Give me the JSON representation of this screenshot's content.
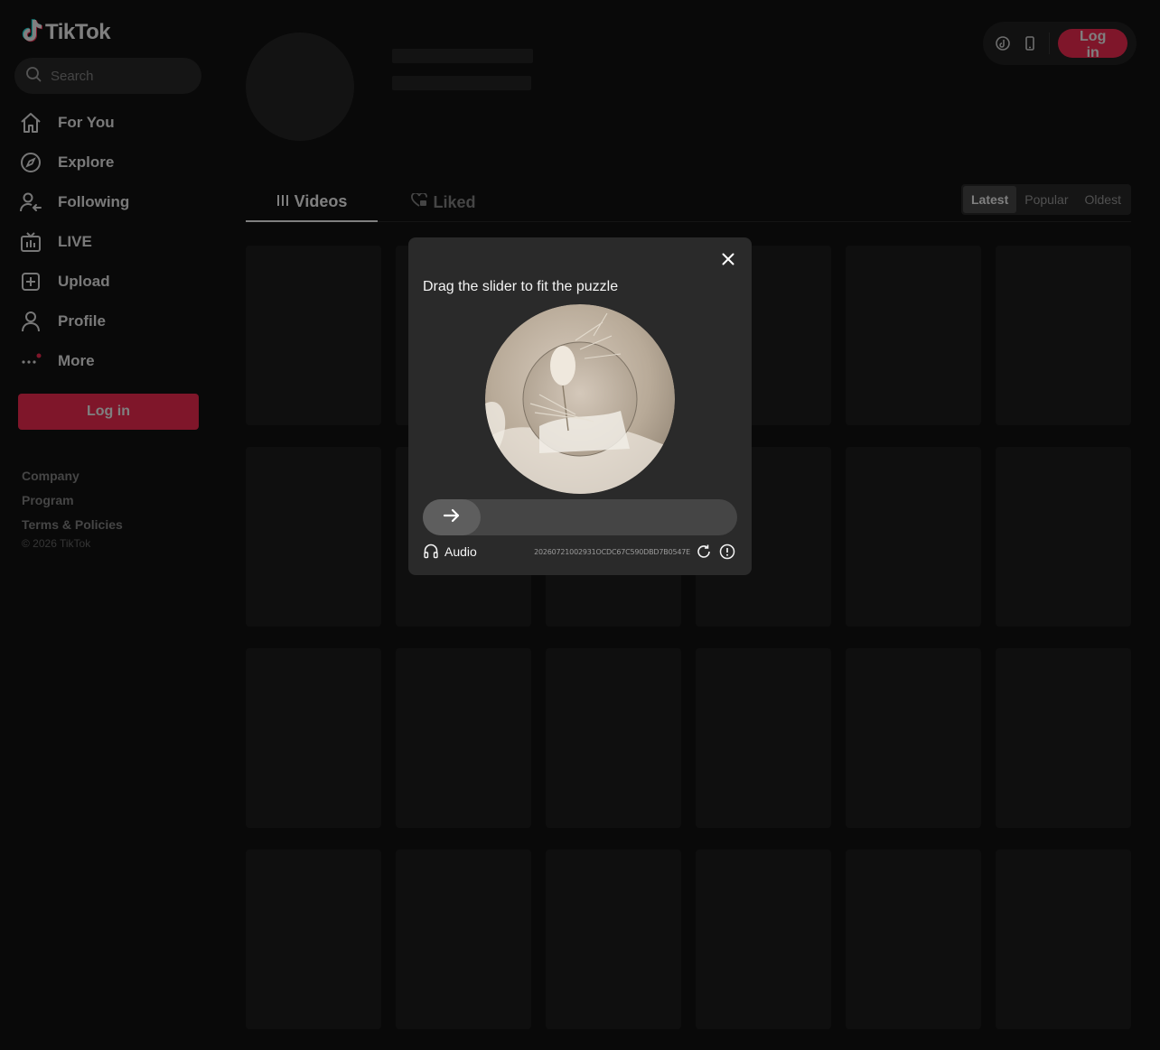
{
  "app": {
    "logo_text": "TikTok"
  },
  "search": {
    "placeholder": "Search"
  },
  "nav": {
    "items": [
      {
        "label": "For You",
        "icon": "home-icon"
      },
      {
        "label": "Explore",
        "icon": "compass-icon"
      },
      {
        "label": "Following",
        "icon": "following-icon"
      },
      {
        "label": "LIVE",
        "icon": "live-icon"
      },
      {
        "label": "Upload",
        "icon": "upload-icon"
      },
      {
        "label": "Profile",
        "icon": "profile-icon"
      },
      {
        "label": "More",
        "icon": "more-icon"
      }
    ]
  },
  "sidebar": {
    "login_label": "Log in"
  },
  "footer": {
    "links": [
      "Company",
      "Program",
      "Terms & Policies"
    ],
    "copyright": "© 2026 TikTok"
  },
  "topbar": {
    "login_label": "Log in"
  },
  "tabs": [
    {
      "label": "Videos",
      "active": true
    },
    {
      "label": "Liked",
      "active": false
    }
  ],
  "sort": {
    "options": [
      "Latest",
      "Popular",
      "Oldest"
    ],
    "selected": "Latest"
  },
  "captcha": {
    "title": "Drag the slider to fit the puzzle",
    "audio_label": "Audio",
    "code": "20260721002931OCDC67C590DBD7B0547E"
  },
  "colors": {
    "brand": "#fe2c55",
    "background": "#121212",
    "modal": "#2a2a2a"
  }
}
